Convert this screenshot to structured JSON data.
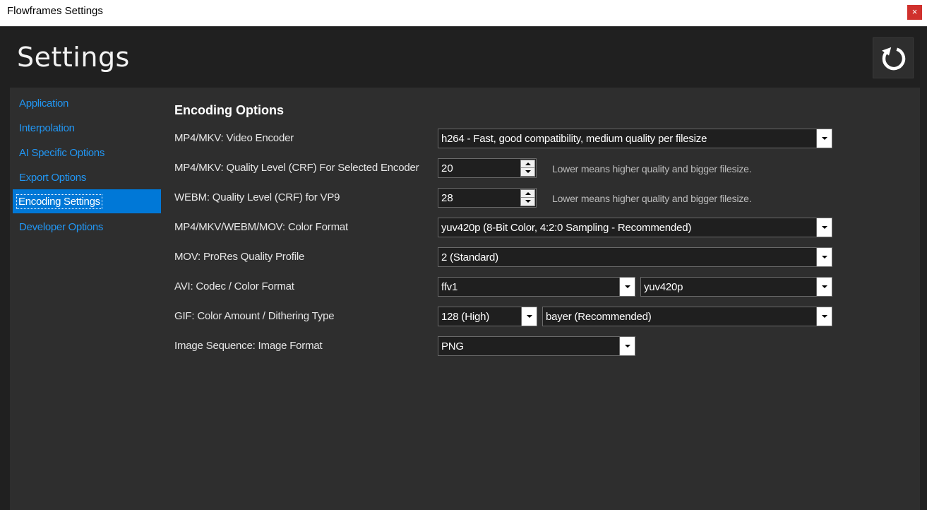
{
  "window": {
    "title": "Flowframes Settings",
    "close_glyph": "×"
  },
  "header": {
    "title": "Settings",
    "reset_icon": "reset-icon"
  },
  "nav": {
    "items": [
      {
        "label": "Application"
      },
      {
        "label": "Interpolation"
      },
      {
        "label": "AI Specific Options"
      },
      {
        "label": "Export Options"
      },
      {
        "label": "Encoding Settings"
      },
      {
        "label": "Developer Options"
      }
    ],
    "active_index": 4
  },
  "encoding": {
    "section_title": "Encoding Options",
    "video_encoder": {
      "label": "MP4/MKV: Video Encoder",
      "value": "h264 - Fast, good compatibility, medium quality per filesize"
    },
    "crf_selected": {
      "label": "MP4/MKV: Quality Level (CRF) For Selected Encoder",
      "value": "20",
      "hint": "Lower means higher quality and bigger filesize."
    },
    "crf_vp9": {
      "label": "WEBM: Quality Level (CRF) for VP9",
      "value": "28",
      "hint": "Lower means higher quality and bigger filesize."
    },
    "color_format": {
      "label": "MP4/MKV/WEBM/MOV: Color Format",
      "value": "yuv420p (8-Bit Color, 4:2:0 Sampling - Recommended)"
    },
    "prores_profile": {
      "label": "MOV: ProRes Quality Profile",
      "value": "2 (Standard)"
    },
    "avi": {
      "label": "AVI: Codec / Color Format",
      "codec": "ffv1",
      "color_format": "yuv420p"
    },
    "gif": {
      "label": "GIF: Color Amount / Dithering Type",
      "colors": "128 (High)",
      "dither": "bayer (Recommended)"
    },
    "image_sequence": {
      "label": "Image Sequence: Image Format",
      "value": "PNG"
    }
  },
  "colors": {
    "accent": "#0078d7",
    "nav_link": "#2196f3",
    "background": "#202020",
    "panel": "#2e2e2e"
  }
}
